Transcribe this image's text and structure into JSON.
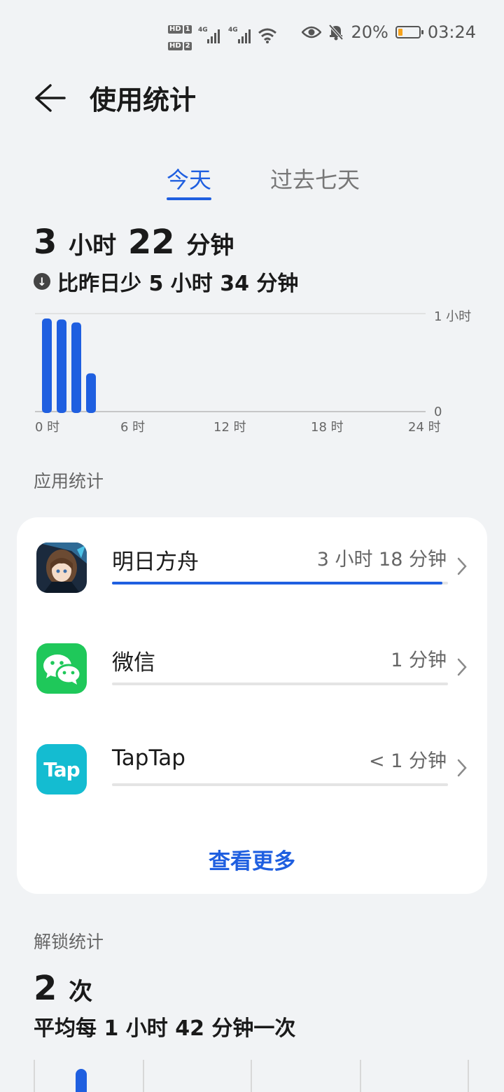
{
  "status": {
    "hd1": "HD",
    "sim1": "1",
    "hd2": "HD",
    "sim2": "2",
    "net1": "4G",
    "net2": "4G",
    "battery_pct": "20%",
    "battery_level": 0.2,
    "time": "03:24",
    "icons": [
      "eye-icon",
      "bell-off-icon",
      "wifi-icon",
      "battery-icon"
    ]
  },
  "header": {
    "title": "使用统计"
  },
  "tabs": [
    {
      "label": "今天",
      "active": true
    },
    {
      "label": "过去七天",
      "active": false
    }
  ],
  "summary": {
    "hours": "3",
    "hours_unit": "小时",
    "minutes": "22",
    "minutes_unit": "分钟",
    "compare": "比昨日少 5 小时 34 分钟"
  },
  "chart_data": {
    "type": "bar",
    "x_unit": "hour",
    "x": [
      0,
      1,
      2,
      3
    ],
    "values": [
      0.95,
      0.94,
      0.91,
      0.39
    ],
    "ylim": [
      0,
      1
    ],
    "y_ticks": [
      "1 小时",
      "0"
    ],
    "x_ticks": [
      "0 时",
      "6 时",
      "12 时",
      "18 时",
      "24 时"
    ],
    "xlim": [
      0,
      24
    ],
    "color": "#1f5fe0"
  },
  "apps_section": {
    "label": "应用统计"
  },
  "apps": [
    {
      "name": "明日方舟",
      "time": "3 小时 18 分钟",
      "share": 0.984,
      "icon": "arknights-icon"
    },
    {
      "name": "微信",
      "time": "1 分钟",
      "share": 0,
      "icon": "wechat-icon"
    },
    {
      "name": "TapTap",
      "time": "< 1 分钟",
      "share": 0,
      "icon": "taptap-icon",
      "icon_text": "Tap"
    }
  ],
  "see_more": "查看更多",
  "unlock": {
    "label": "解锁统计",
    "count": "2",
    "count_unit": "次",
    "average": "平均每 1 小时 42 分钟一次"
  },
  "colors": {
    "accent": "#1f5fe0",
    "background": "#f1f3f5",
    "wechat": "#1fc85a",
    "taptap": "#14bcd1"
  }
}
